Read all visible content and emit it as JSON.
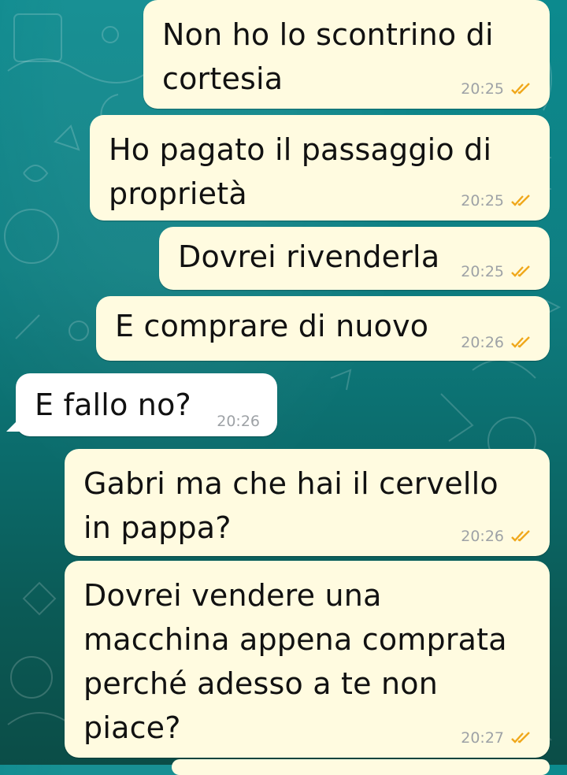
{
  "messages": [
    {
      "direction": "out",
      "text": "Non ho lo scontrino di cortesia",
      "time": "20:25",
      "status_icon": "double-check-icon"
    },
    {
      "direction": "out",
      "text": "Ho pagato il passaggio di proprietà",
      "time": "20:25",
      "status_icon": "double-check-icon"
    },
    {
      "direction": "out",
      "text": "Dovrei rivenderla",
      "time": "20:25",
      "status_icon": "double-check-icon"
    },
    {
      "direction": "out",
      "text": "E comprare di nuovo",
      "time": "20:26",
      "status_icon": "double-check-icon"
    },
    {
      "direction": "in",
      "text": "E fallo no?",
      "time": "20:26"
    },
    {
      "direction": "out",
      "text": "Gabri ma che hai il cervello in pappa?",
      "time": "20:26",
      "status_icon": "double-check-icon"
    },
    {
      "direction": "out",
      "text": "Dovrei vendere una macchina appena comprata perché adesso a te non piace?",
      "time": "20:27",
      "status_icon": "double-check-icon"
    }
  ],
  "colors": {
    "outgoing_bubble": "#fffbe0",
    "incoming_bubble": "#ffffff",
    "tick": "#f0a81c",
    "wallpaper_top": "#0c8a8e",
    "wallpaper_bottom": "#0b4d47"
  }
}
